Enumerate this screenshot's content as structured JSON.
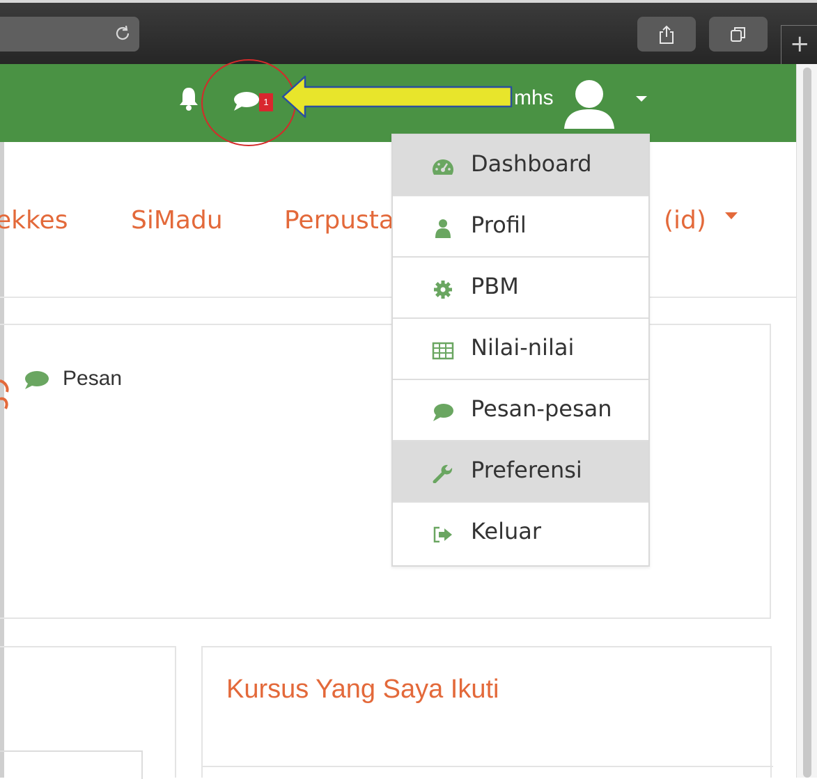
{
  "navbar": {
    "username": "mhs",
    "message_badge": "1"
  },
  "subnav": {
    "links": [
      "ekkes",
      "SiMadu",
      "Perpusta",
      "(id)"
    ]
  },
  "content": {
    "pesan_label": "Pesan",
    "courses_title": "Kursus Yang Saya Ikuti"
  },
  "dropdown": {
    "items": [
      {
        "label": "Dashboard",
        "icon": "dashboard-icon"
      },
      {
        "label": "Profil",
        "icon": "user-icon"
      },
      {
        "label": "PBM",
        "icon": "gear-icon"
      },
      {
        "label": "Nilai-nilai",
        "icon": "table-icon"
      },
      {
        "label": "Pesan-pesan",
        "icon": "speech-bubble-icon"
      },
      {
        "label": "Preferensi",
        "icon": "wrench-icon"
      },
      {
        "label": "Keluar",
        "icon": "sign-out-icon"
      }
    ]
  },
  "colors": {
    "navbar": "#4a9244",
    "link": "#e3693a",
    "icon_green": "#6aa661",
    "badge": "#d9272e",
    "annotation_circle": "#d42a2a",
    "annotation_arrow": "#e8e52b"
  }
}
